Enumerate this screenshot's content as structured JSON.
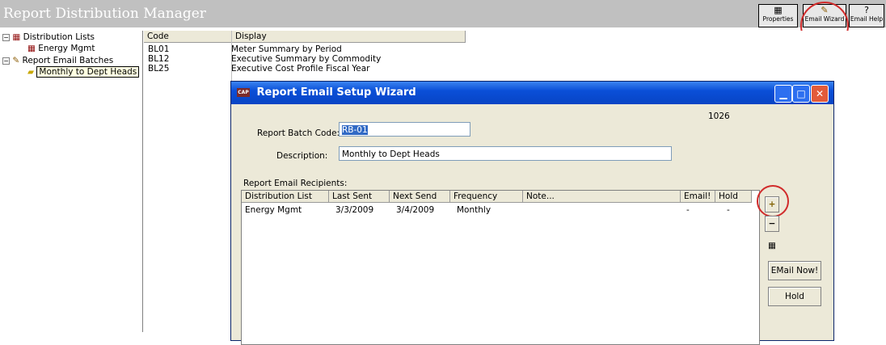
{
  "app": {
    "title": "Report Distribution Manager"
  },
  "toolbar": {
    "properties": "Properties",
    "email_wizard": "Email Wizard",
    "email_help": "Email Help"
  },
  "tree": {
    "distribution_lists": "Distribution Lists",
    "energy_mgmt": "Energy Mgmt",
    "report_email_batches": "Report Email Batches",
    "monthly": "Monthly to Dept Heads"
  },
  "list": {
    "headers": {
      "code": "Code",
      "display": "Display"
    },
    "rows": [
      {
        "code": "BL01",
        "display": "Meter Summary by Period"
      },
      {
        "code": "BL12",
        "display": "Executive Summary by Commodity"
      },
      {
        "code": "BL25",
        "display": "Executive Cost Profile Fiscal Year"
      }
    ]
  },
  "dialog": {
    "title": "Report Email Setup Wizard",
    "app_icon": "CAP",
    "id": "1026",
    "batch_code_label": "Report Batch Code:",
    "batch_code": "RB-01",
    "description_label": "Description:",
    "description": "Monthly to Dept Heads",
    "recipients_label": "Report Email Recipients:",
    "columns": {
      "dist": "Distribution List",
      "last": "Last Sent",
      "next": "Next Send",
      "freq": "Frequency",
      "note": "Note...",
      "email": "Email!",
      "hold": "Hold"
    },
    "rows": [
      {
        "dist": "Energy Mgmt",
        "last": "3/3/2009",
        "next": "3/4/2009",
        "freq": "Monthly",
        "note": "",
        "email": "-",
        "hold": "-"
      }
    ],
    "add": "+",
    "remove": "−",
    "email_now": "EMail Now!",
    "hold_btn": "Hold"
  }
}
